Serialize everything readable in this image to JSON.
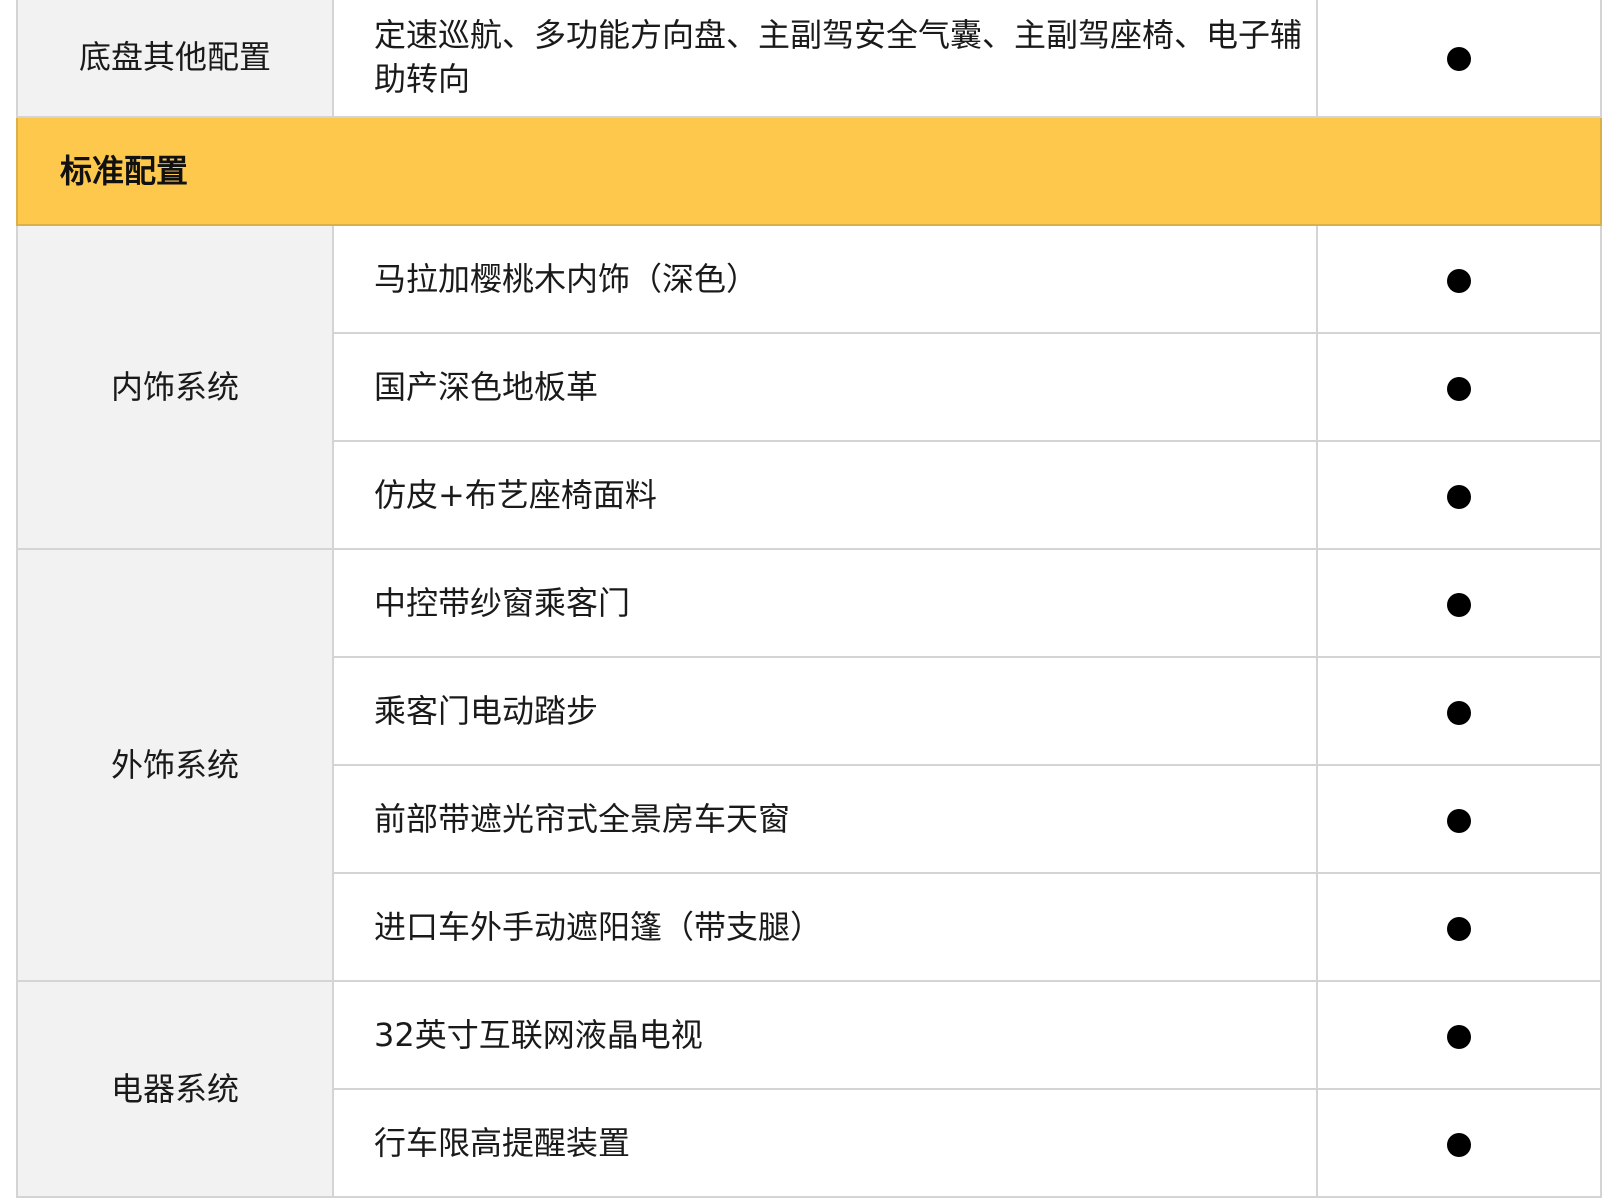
{
  "table": {
    "top_row": {
      "category": "底盘其他配置",
      "item": "定速巡航、多功能方向盘、主副驾安全气囊、主副驾座椅、电子辅助转向",
      "mark": "●"
    },
    "section_title": "标准配置",
    "groups": [
      {
        "category": "内饰系统",
        "items": [
          "马拉加樱桃木内饰（深色）",
          "国产深色地板革",
          "仿皮+布艺座椅面料"
        ]
      },
      {
        "category": "外饰系统",
        "items": [
          "中控带纱窗乘客门",
          "乘客门电动踏步",
          "前部带遮光帘式全景房车天窗",
          "进口车外手动遮阳篷（带支腿）"
        ]
      },
      {
        "category": "电器系统",
        "items": [
          "32英寸互联网液晶电视",
          "行车限高提醒装置"
        ]
      }
    ]
  },
  "colors": {
    "section_bg": "#fec84d",
    "category_bg": "#f2f2f2",
    "border": "#d4d4d4",
    "dot": "#000000"
  }
}
